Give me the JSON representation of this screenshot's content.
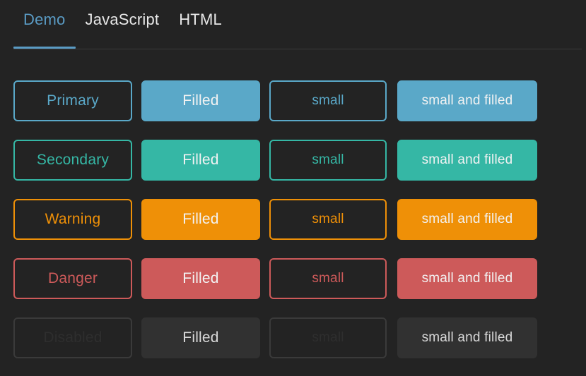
{
  "tabs": [
    {
      "label": "Demo",
      "active": true
    },
    {
      "label": "JavaScript",
      "active": false
    },
    {
      "label": "HTML",
      "active": false
    }
  ],
  "colors": {
    "background": "#232323",
    "tab_active": "#5a9bc4",
    "tab_inactive": "#e8e8e8",
    "divider": "#3b3b3b",
    "primary": "#5aa8c8",
    "secondary": "#35b7a5",
    "warning": "#ef9007",
    "danger": "#cd5a5a",
    "disabled_border": "#3a3a3a",
    "disabled_text": "#6a6a6a",
    "disabled_fill": "#313131",
    "filled_text": "#f2f2f2",
    "disabled_filled_text": "#d8d8d8"
  },
  "columns": [
    "outline",
    "filled",
    "outline-small",
    "filled-small"
  ],
  "rows": [
    {
      "variant": "primary",
      "accent": "#5aa8c8",
      "disabled": false,
      "buttons": [
        {
          "label": "Primary",
          "style": "outline"
        },
        {
          "label": "Filled",
          "style": "filled"
        },
        {
          "label": "small",
          "style": "outline"
        },
        {
          "label": "small and filled",
          "style": "filled"
        }
      ]
    },
    {
      "variant": "secondary",
      "accent": "#35b7a5",
      "disabled": false,
      "buttons": [
        {
          "label": "Secondary",
          "style": "outline"
        },
        {
          "label": "Filled",
          "style": "filled"
        },
        {
          "label": "small",
          "style": "outline"
        },
        {
          "label": "small and filled",
          "style": "filled"
        }
      ]
    },
    {
      "variant": "warning",
      "accent": "#ef9007",
      "disabled": false,
      "buttons": [
        {
          "label": "Warning",
          "style": "outline"
        },
        {
          "label": "Filled",
          "style": "filled"
        },
        {
          "label": "small",
          "style": "outline"
        },
        {
          "label": "small and filled",
          "style": "filled"
        }
      ]
    },
    {
      "variant": "danger",
      "accent": "#cd5a5a",
      "disabled": false,
      "buttons": [
        {
          "label": "Danger",
          "style": "outline"
        },
        {
          "label": "Filled",
          "style": "filled"
        },
        {
          "label": "small",
          "style": "outline"
        },
        {
          "label": "small and filled",
          "style": "filled"
        }
      ]
    },
    {
      "variant": "disabled",
      "accent": "#6a6a6a",
      "disabled": true,
      "buttons": [
        {
          "label": "Disabled",
          "style": "outline"
        },
        {
          "label": "Filled",
          "style": "filled"
        },
        {
          "label": "small",
          "style": "outline"
        },
        {
          "label": "small and filled",
          "style": "filled"
        }
      ]
    }
  ]
}
